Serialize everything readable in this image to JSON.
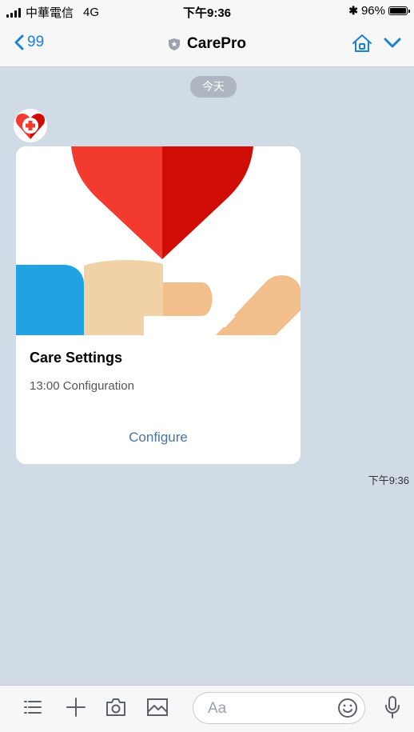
{
  "status": {
    "carrier": "中華電信",
    "network": "4G",
    "time": "下午9:36",
    "battery": "96%"
  },
  "nav": {
    "back_count": "99",
    "title": "CarePro"
  },
  "chat": {
    "date_label": "今天",
    "card": {
      "title": "Care Settings",
      "subtitle": "13:00 Configuration",
      "action": "Configure"
    },
    "timestamp": "下午9:36"
  },
  "composer": {
    "placeholder": "Aa"
  },
  "colors": {
    "accent": "#1a82d6",
    "heart_light": "#f23a2e",
    "heart_dark": "#cf0c06",
    "sleeve_blue": "#21a2e3",
    "hand_light": "#f0d2a6",
    "hand_dark": "#f2be8c",
    "background": "#d1dbe5"
  }
}
